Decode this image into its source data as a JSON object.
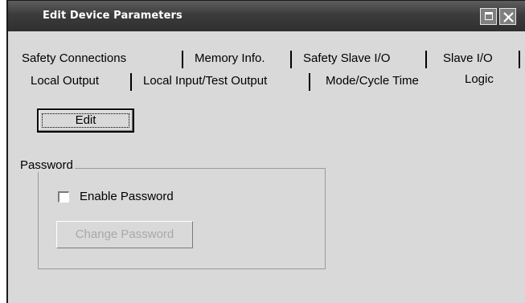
{
  "window": {
    "title": "Edit Device Parameters"
  },
  "tabs": {
    "row1": [
      {
        "label": "Safety Connections"
      },
      {
        "label": "Memory Info."
      },
      {
        "label": "Safety Slave I/O"
      },
      {
        "label": "Slave I/O"
      }
    ],
    "row2": [
      {
        "label": "Local Output"
      },
      {
        "label": "Local Input/Test Output"
      },
      {
        "label": "Mode/Cycle Time"
      },
      {
        "label": "Logic",
        "selected": true
      }
    ]
  },
  "logic_panel": {
    "edit_label": "Edit",
    "password_group_label": "Password",
    "enable_password_label": "Enable Password",
    "enable_password_checked": false,
    "change_password_label": "Change Password",
    "change_password_enabled": false
  },
  "icons": {
    "maximize": "maximize-icon",
    "close": "close-icon"
  },
  "colors": {
    "titlebar": "#3c3c3c",
    "face": "#d9d9d9",
    "disabled_text": "#a8a8a8"
  }
}
